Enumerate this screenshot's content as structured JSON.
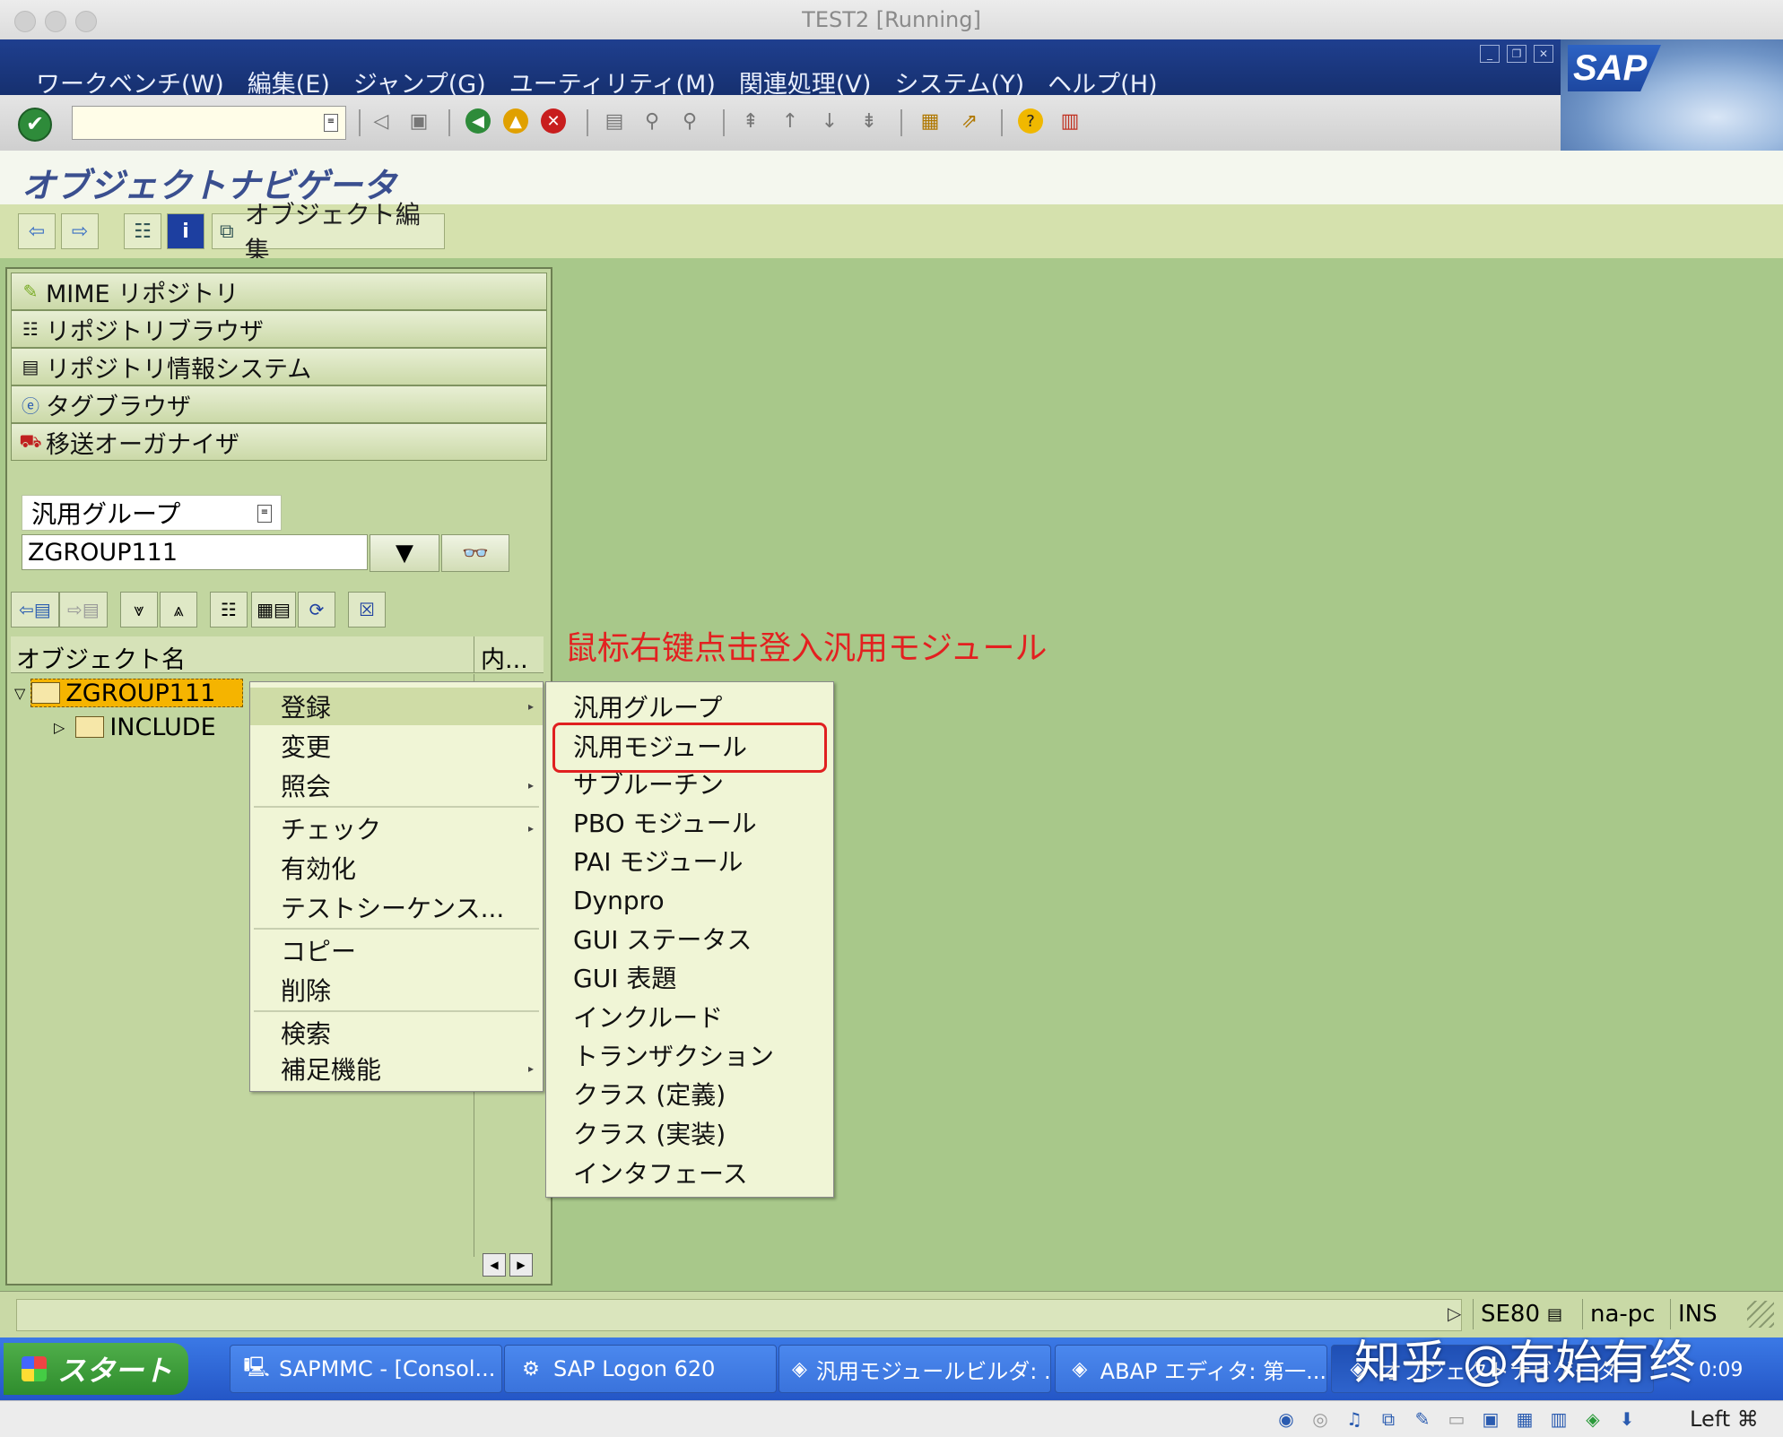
{
  "window": {
    "title": "TEST2 [Running]"
  },
  "menubar": {
    "items": [
      "ワークベンチ(W)",
      "編集(E)",
      "ジャンプ(G)",
      "ユーティリティ(M)",
      "関連処理(V)",
      "システム(Y)",
      "ヘルプ(H)"
    ],
    "logo": "SAP"
  },
  "toolbar": {
    "icons": [
      "enter-icon",
      "command-field",
      "back-triangle-icon",
      "save-icon",
      "back-icon",
      "exit-icon",
      "cancel-icon",
      "print-icon",
      "find-icon",
      "find-next-icon",
      "first-page-icon",
      "prev-page-icon",
      "next-page-icon",
      "last-page-icon",
      "new-session-icon",
      "shortcut-icon",
      "help-icon",
      "layout-icon"
    ]
  },
  "page": {
    "title": "オブジェクトナビゲータ"
  },
  "app_toolbar": {
    "edit_object_label": "オブジェクト編集"
  },
  "navigator": {
    "buttons": [
      "MIME リポジトリ",
      "リポジトリブラウザ",
      "リポジトリ情報システム",
      "タグブラウザ",
      "移送オーガナイザ"
    ],
    "object_type": "汎用グループ",
    "object_name": "ZGROUP111",
    "tree_columns": [
      "オブジェクト名",
      "内..."
    ],
    "tree": [
      {
        "label": "ZGROUP111",
        "expanded": true,
        "selected": true
      },
      {
        "label": "INCLUDE",
        "expanded": false
      }
    ]
  },
  "context_menu": {
    "items": [
      {
        "label": "登録",
        "submenu": true,
        "highlight": true
      },
      {
        "label": "変更",
        "submenu": false
      },
      {
        "label": "照会",
        "submenu": true
      },
      {
        "label": "チェック",
        "submenu": true
      },
      {
        "label": "有効化",
        "submenu": false
      },
      {
        "label": "テストシーケンス...",
        "submenu": false
      },
      {
        "label": "コピー",
        "submenu": false
      },
      {
        "label": "削除",
        "submenu": false
      },
      {
        "label": "検索",
        "submenu": false
      },
      {
        "label": "補足機能",
        "submenu": true
      }
    ]
  },
  "sub_menu": {
    "items": [
      "汎用グループ",
      "汎用モジュール",
      "サブルーチン",
      "PBO モジュール",
      "PAI モジュール",
      "Dynpro",
      "GUI ステータス",
      "GUI 表題",
      "インクルード",
      "トランザクション",
      "クラス (定義)",
      "クラス (実装)",
      "インタフェース"
    ],
    "highlighted": "汎用モジュール"
  },
  "annotation": {
    "text": "鼠标右键点击登入汎用モジュール",
    "color": "#e32020"
  },
  "statusbar": {
    "transaction": "SE80",
    "server": "na-pc",
    "mode": "INS"
  },
  "taskbar": {
    "start_label": "スタート",
    "buttons": [
      "SAPMMC - [Consol...",
      "SAP Logon 620",
      "汎用モジュールビルダ: ...",
      "ABAP エディタ: 第一...",
      "オブジェクトナビゲータ"
    ],
    "time": "0:09"
  },
  "watermark": "知乎 @有始有终",
  "vbox": {
    "host_key": "Left ⌘"
  },
  "colors": {
    "sap_green": "#a8c88a",
    "menubar_blue": "#1f3f8f",
    "highlight_red": "#e02020"
  }
}
